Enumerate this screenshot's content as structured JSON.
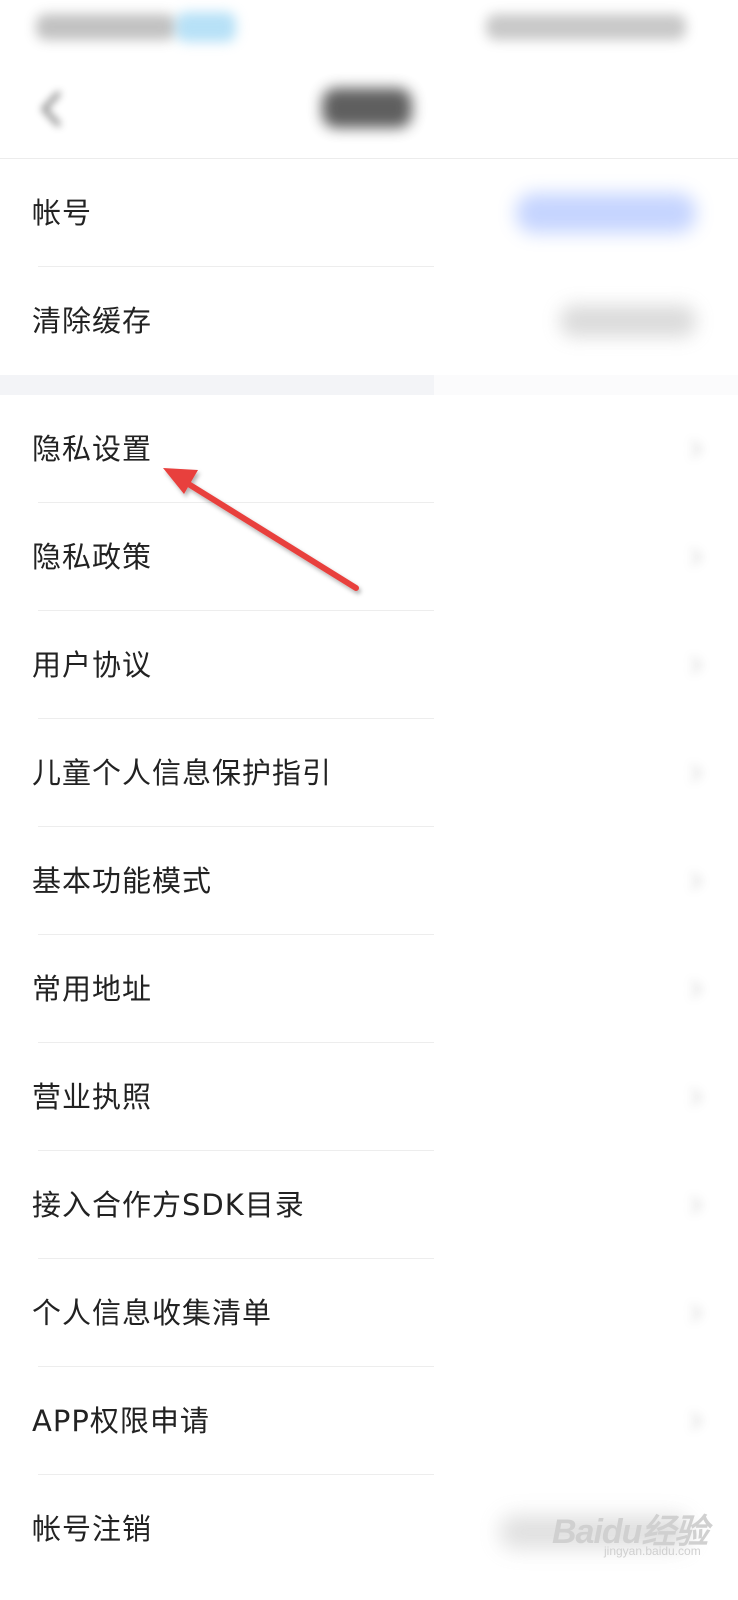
{
  "colors": {
    "accent_link": "#5b86ff",
    "annotation_arrow": "#e8403d",
    "section_gap": "#f3f4f7"
  },
  "nav": {
    "back_icon": "chevron-left-icon"
  },
  "group1": [
    {
      "label": "帐号"
    },
    {
      "label": "清除缓存"
    }
  ],
  "group2": [
    {
      "label": "隐私设置"
    },
    {
      "label": "隐私政策"
    },
    {
      "label": "用户协议"
    },
    {
      "label": "儿童个人信息保护指引"
    },
    {
      "label": "基本功能模式"
    },
    {
      "label": "常用地址"
    },
    {
      "label": "营业执照"
    },
    {
      "label": "接入合作方SDK目录"
    },
    {
      "label": "个人信息收集清单"
    },
    {
      "label": "APP权限申请"
    },
    {
      "label": "帐号注销"
    }
  ],
  "watermark": {
    "brand": "Baidu经验",
    "sub": "jingyan.baidu.com"
  }
}
